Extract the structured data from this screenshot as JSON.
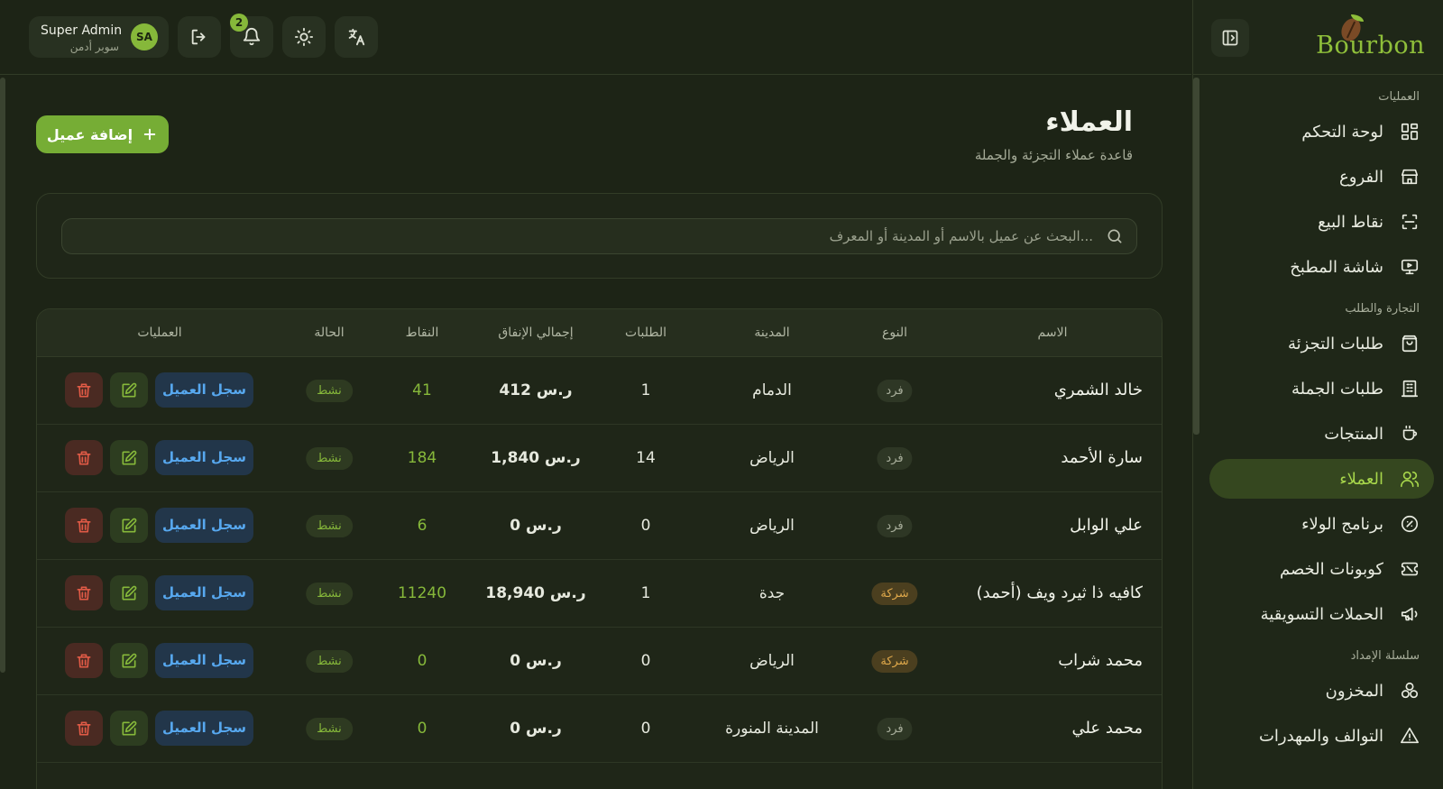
{
  "brand": {
    "name": "Bourbon"
  },
  "header": {
    "user_name": "Super Admin",
    "user_role": "سوبر أدمن",
    "avatar_initials": "SA",
    "notification_count": "2"
  },
  "sidebar": {
    "sections": [
      {
        "title": "العمليات",
        "items": [
          {
            "label": "لوحة التحكم",
            "icon": "dashboard-icon"
          },
          {
            "label": "الفروع",
            "icon": "store-icon"
          },
          {
            "label": "نقاط البيع",
            "icon": "scan-icon"
          },
          {
            "label": "شاشة المطبخ",
            "icon": "monitor-icon"
          }
        ]
      },
      {
        "title": "التجارة والطلب",
        "items": [
          {
            "label": "طلبات التجزئة",
            "icon": "bag-icon"
          },
          {
            "label": "طلبات الجملة",
            "icon": "building-icon"
          },
          {
            "label": "المنتجات",
            "icon": "cup-icon"
          },
          {
            "label": "العملاء",
            "icon": "users-icon",
            "active": true
          },
          {
            "label": "برنامج الولاء",
            "icon": "badge-icon"
          },
          {
            "label": "كوبونات الخصم",
            "icon": "ticket-icon"
          },
          {
            "label": "الحملات التسويقية",
            "icon": "megaphone-icon"
          }
        ]
      },
      {
        "title": "سلسلة الإمداد",
        "items": [
          {
            "label": "المخزون",
            "icon": "boxes-icon"
          },
          {
            "label": "التوالف والمهدرات",
            "icon": "warning-icon"
          }
        ]
      }
    ]
  },
  "main": {
    "title": "العملاء",
    "subtitle": "قاعدة عملاء التجزئة والجملة",
    "add_button": "إضافة عميل",
    "search_placeholder": "البحث عن عميل بالاسم أو المدينة أو المعرف..."
  },
  "table": {
    "columns": {
      "name": "الاسم",
      "type": "النوع",
      "city": "المدينة",
      "orders": "الطلبات",
      "spend": "إجمالي الإنفاق",
      "points": "النقاط",
      "status": "الحالة",
      "actions": "العمليات"
    },
    "log_label": "سجل العميل",
    "rows": [
      {
        "name": "خالد الشمري",
        "type": "فرد",
        "type_kind": "individual",
        "city": "الدمام",
        "orders": "1",
        "spend": "412 ر.س",
        "points": "41",
        "status": "نشط"
      },
      {
        "name": "سارة الأحمد",
        "type": "فرد",
        "type_kind": "individual",
        "city": "الرياض",
        "orders": "14",
        "spend": "1,840 ر.س",
        "points": "184",
        "status": "نشط"
      },
      {
        "name": "علي الوابل",
        "type": "فرد",
        "type_kind": "individual",
        "city": "الرياض",
        "orders": "0",
        "spend": "0 ر.س",
        "points": "6",
        "status": "نشط"
      },
      {
        "name": "كافيه ذا ثيرد ويف (أحمد)",
        "type": "شركة",
        "type_kind": "company",
        "city": "جدة",
        "orders": "1",
        "spend": "18,940 ر.س",
        "points": "11240",
        "status": "نشط"
      },
      {
        "name": "محمد شراب",
        "type": "شركة",
        "type_kind": "company",
        "city": "الرياض",
        "orders": "0",
        "spend": "0 ر.س",
        "points": "0",
        "status": "نشط"
      },
      {
        "name": "محمد علي",
        "type": "فرد",
        "type_kind": "individual",
        "city": "المدينة المنورة",
        "orders": "0",
        "spend": "0 ر.س",
        "points": "0",
        "status": "نشط"
      }
    ]
  },
  "colors": {
    "accent": "#86b83a",
    "background": "#1d2416",
    "danger": "#e05a46",
    "info": "#57a8ef"
  }
}
